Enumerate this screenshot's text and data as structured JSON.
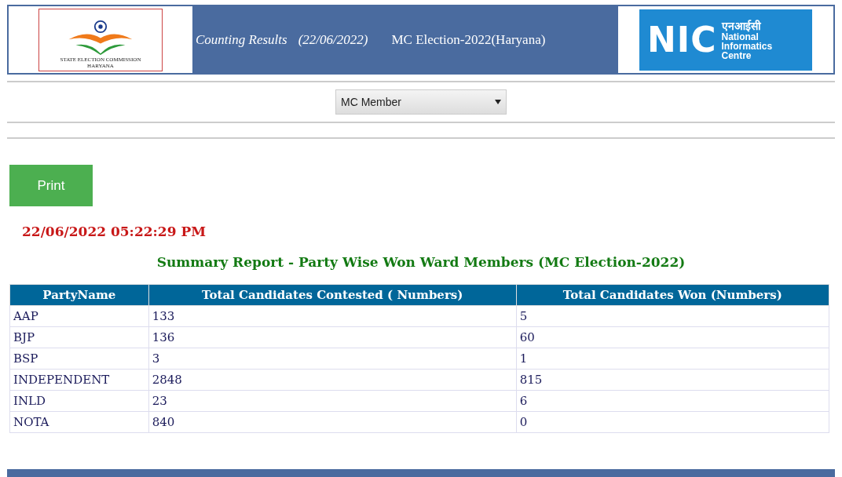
{
  "header": {
    "left_logo": {
      "caption_line1": "STATE ELECTION COMMISSION",
      "caption_line2": "HARYANA"
    },
    "title": "Counting Results",
    "date": "(22/06/2022)",
    "election": "MC Election-2022(Haryana)",
    "right_logo": {
      "mark": "NIC",
      "hindi": "एनआईसी",
      "line1": "National",
      "line2": "Informatics",
      "line3": "Centre"
    }
  },
  "dropdown": {
    "value": "MC Member"
  },
  "print_button": "Print",
  "timestamp": "22/06/2022 05:22:29 PM",
  "report_title": "Summary Report - Party Wise Won Ward Members (MC Election-2022)",
  "table": {
    "columns": [
      "PartyName",
      "Total Candidates Contested ( Numbers)",
      "Total Candidates Won (Numbers)"
    ],
    "rows": [
      [
        "AAP",
        "133",
        "5"
      ],
      [
        "BJP",
        "136",
        "60"
      ],
      [
        "BSP",
        "3",
        "1"
      ],
      [
        "INDEPENDENT",
        "2848",
        "815"
      ],
      [
        "INLD",
        "23",
        "6"
      ],
      [
        "NOTA",
        "840",
        "0"
      ]
    ]
  }
}
